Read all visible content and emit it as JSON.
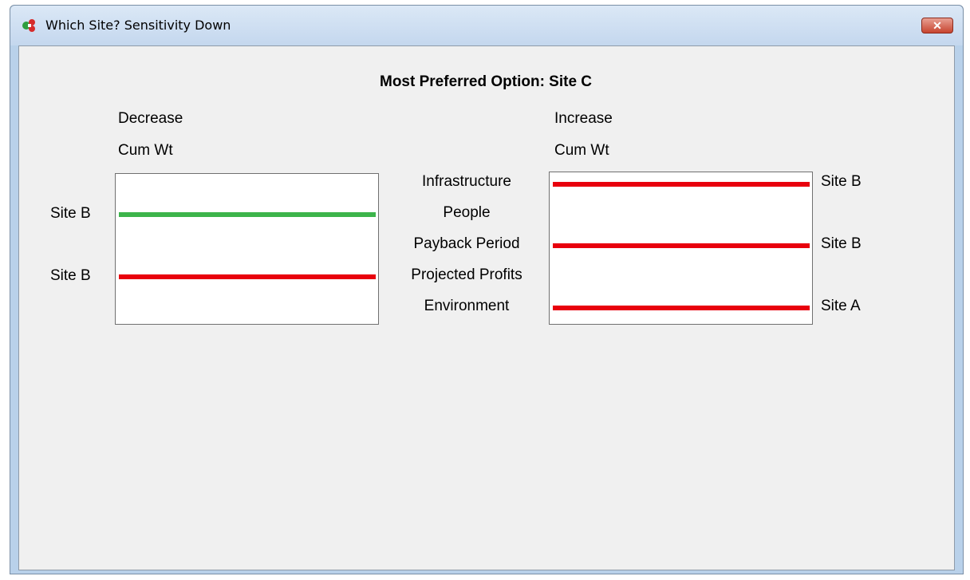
{
  "window": {
    "title": "Which Site? Sensitivity Down",
    "close_symbol": "✕"
  },
  "main": {
    "heading": "Most Preferred Option: Site C",
    "decrease": {
      "label1": "Decrease",
      "label2": "Cum Wt",
      "bars": [
        {
          "site": "Site B",
          "color": "#3cb44b",
          "criterion": "People"
        },
        {
          "site": "Site B",
          "color": "#e8000d",
          "criterion": "Projected Profits"
        }
      ]
    },
    "increase": {
      "label1": "Increase",
      "label2": "Cum Wt",
      "bars": [
        {
          "site": "Site B",
          "color": "#e8000d",
          "criterion": "Infrastructure"
        },
        {
          "site": "Site B",
          "color": "#e8000d",
          "criterion": "Payback Period"
        },
        {
          "site": "Site A",
          "color": "#e8000d",
          "criterion": "Environment"
        }
      ]
    },
    "criteria": [
      "Infrastructure",
      "People",
      "Payback Period",
      "Projected Profits",
      "Environment"
    ]
  },
  "colors": {
    "green_bar": "#3cb44b",
    "red_bar": "#e8000d",
    "client_bg": "#f0f0f0"
  }
}
